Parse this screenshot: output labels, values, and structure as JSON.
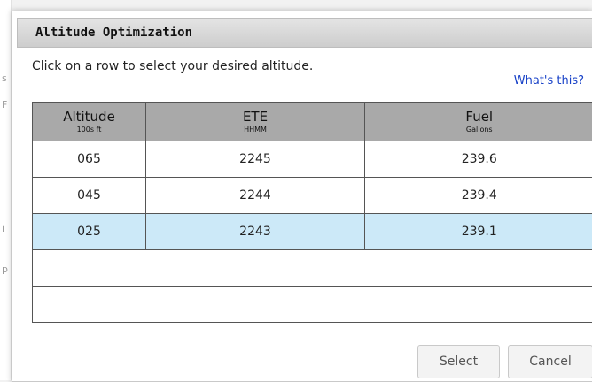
{
  "background": {
    "glyphs": [
      "s",
      "F",
      "i",
      "p"
    ]
  },
  "dialog": {
    "title": "Altitude Optimization",
    "instruction": "Click on a row to select your desired altitude.",
    "help_link": "What's this?",
    "columns": [
      {
        "label": "Altitude",
        "unit": "100s ft"
      },
      {
        "label": "ETE",
        "unit": "HHMM"
      },
      {
        "label": "Fuel",
        "unit": "Gallons"
      }
    ],
    "rows": [
      {
        "altitude": "065",
        "ete": "2245",
        "fuel": "239.6",
        "selected": false
      },
      {
        "altitude": "045",
        "ete": "2244",
        "fuel": "239.4",
        "selected": false
      },
      {
        "altitude": "025",
        "ete": "2243",
        "fuel": "239.1",
        "selected": true
      }
    ],
    "buttons": {
      "select": "Select",
      "cancel": "Cancel"
    },
    "selected_row_color": "#cce9f8"
  }
}
